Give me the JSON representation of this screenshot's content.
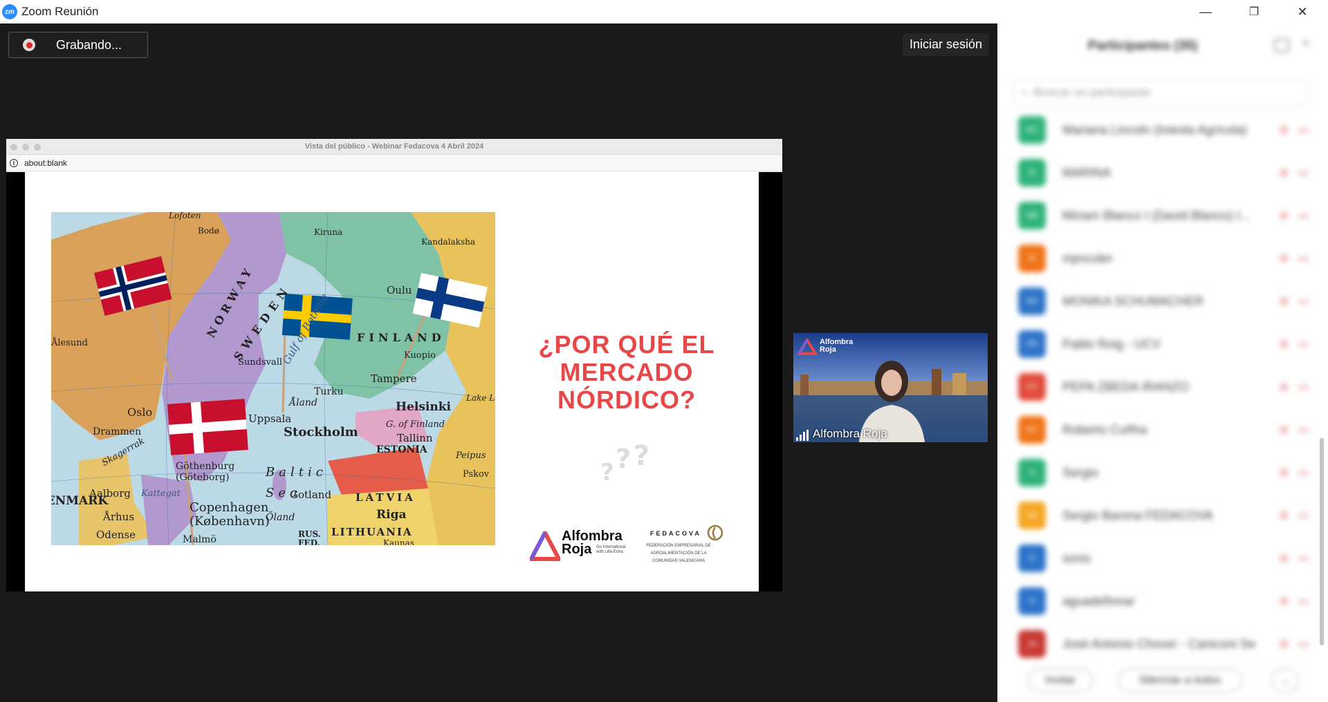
{
  "window": {
    "title": "Zoom Reunión",
    "logo_text": "zm",
    "minimize_symbol": "—",
    "restore_symbol": "❐",
    "close_symbol": "✕"
  },
  "meeting": {
    "recording_label": "Grabando...",
    "signin_label": "Iniciar sesión"
  },
  "shared_screen": {
    "window_title": "Vista del público - Webinar Fedacova 4 Abril 2024",
    "address": "about:blank",
    "slide": {
      "title_lines": [
        "¿POR QUÉ EL",
        "MERCADO",
        "NÓRDICO?"
      ],
      "logo_alfombra_line1": "Alfombra",
      "logo_alfombra_line2": "Roja",
      "logo_alfombra_tagline": "Go International with Lilla Extra",
      "logo_fedacova_name": "FEDACOVA",
      "logo_fedacova_desc": "Federación Empresarial de Agroalimentación de la Comunidad Valenciana",
      "map_labels": [
        "Lofoten",
        "Bodø",
        "Kiruna",
        "Kandalaksha",
        "Oulu",
        "Ålesund",
        "Sundsvall",
        "NORWAY",
        "SWEDEN",
        "FINLAND",
        "Kuopio",
        "Tampere",
        "Helsinki",
        "Turku",
        "Åland",
        "Oslo",
        "Uppsala",
        "Stockholm",
        "G. of Finland",
        "Tallinn",
        "ESTONIA",
        "Peipus",
        "Pskov",
        "Lake Ladoga",
        "Drammen",
        "Skagerrak",
        "Göthenburg (Göteborg)",
        "Aalborg",
        "Gotland",
        "Baltic Sea",
        "LATVIA",
        "Riga",
        "Copenhagen (København)",
        "Malmö",
        "Öland",
        "LITHUANIA",
        "Kaunas",
        "RUS. FED.",
        "Århus",
        "Odense",
        "Kattegat",
        "DENMARK",
        "Gulf of Bothnia"
      ]
    }
  },
  "video": {
    "name": "Alfombra Roja",
    "logo_line1": "Alfombra",
    "logo_line2": "Roja"
  },
  "participants": {
    "header": "Participantes (35)",
    "search_placeholder": "Buscar un participante",
    "rows": [
      {
        "initials": "MC",
        "name": "Mariana Lincoln (Iniesta Agrícola)",
        "color": "#2fb37a"
      },
      {
        "initials": "M",
        "name": "MARINA",
        "color": "#2fb37a"
      },
      {
        "initials": "MB",
        "name": "Miriam Blanco I (David Blanco) I...",
        "color": "#2fb37a"
      },
      {
        "initials": "M",
        "name": "mjmcoler",
        "color": "#f0741a"
      },
      {
        "initials": "MS",
        "name": "MONIKA SCHUMACHER",
        "color": "#2d74c9"
      },
      {
        "initials": "PR",
        "name": "Pablo Roig - UCV",
        "color": "#2d74c9"
      },
      {
        "initials": "PZ",
        "name": "PEPA ZBEDA IRANZO",
        "color": "#e14b3b"
      },
      {
        "initials": "RC",
        "name": "Roberto Cuñha",
        "color": "#f0741a"
      },
      {
        "initials": "S",
        "name": "Sergio",
        "color": "#2fb37a"
      },
      {
        "initials": "SB",
        "name": "Sergio Barona FEDACOVA",
        "color": "#f5a623"
      },
      {
        "initials": "S",
        "name": "sonic",
        "color": "#2d74c9"
      },
      {
        "initials": "A",
        "name": "aguadefinnar",
        "color": "#2d74c9"
      },
      {
        "initials": "JA",
        "name": "José Antonio Chover - Caniconi Ser...",
        "color": "#c93a33"
      }
    ],
    "invite_label": "Invitar",
    "mute_all_label": "Silenciar a todos",
    "more_label": "..."
  }
}
